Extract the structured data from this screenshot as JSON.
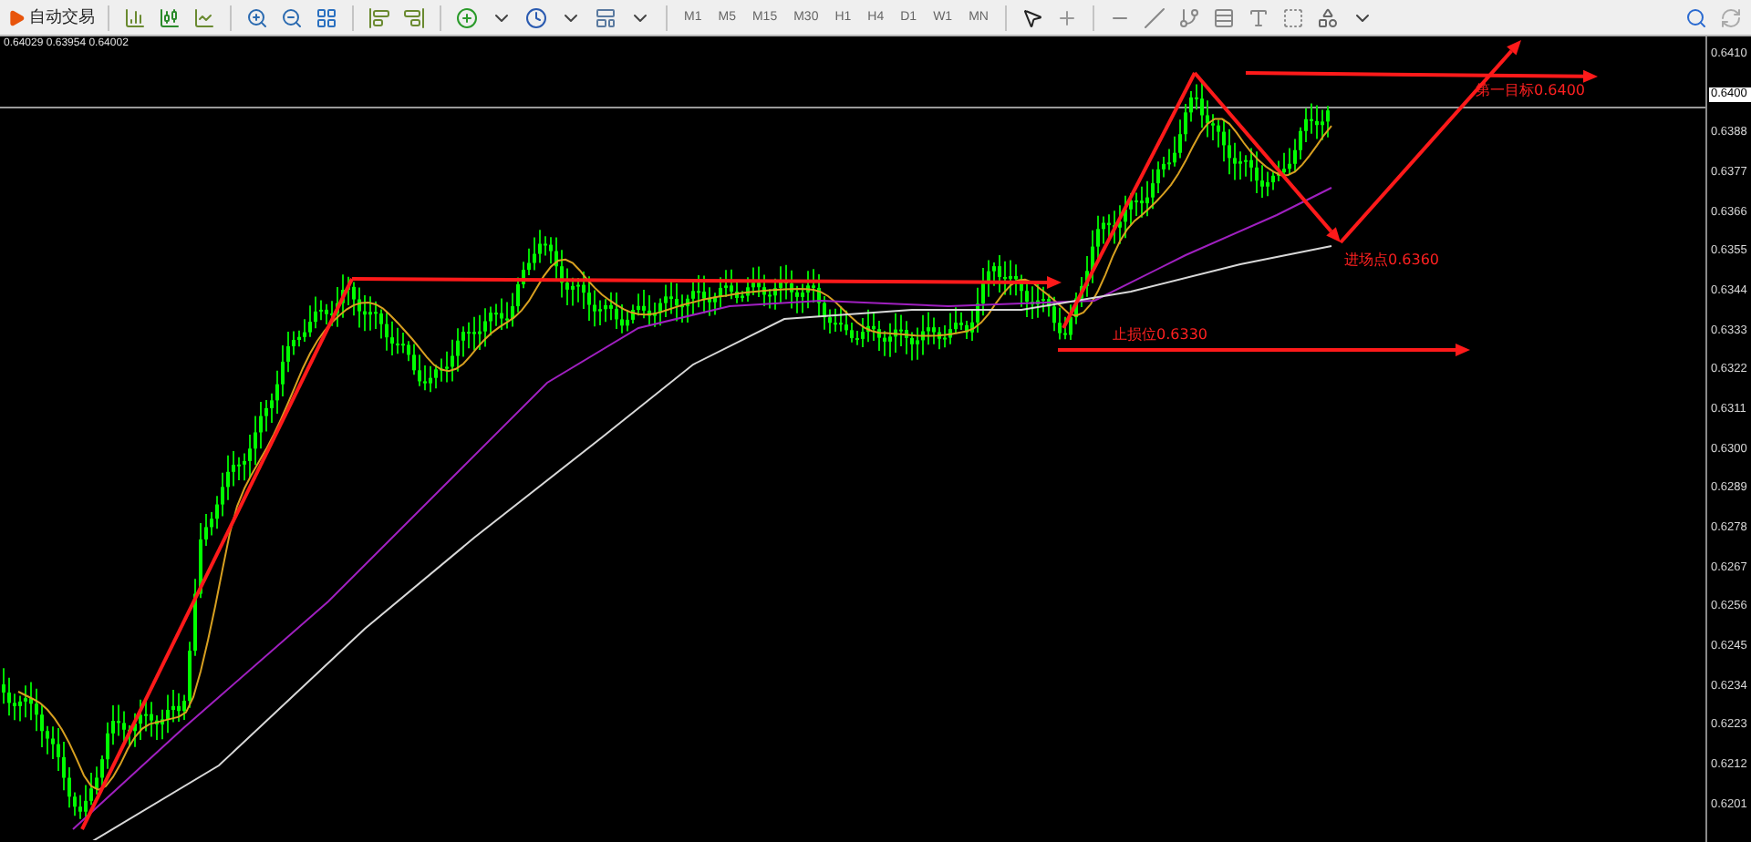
{
  "toolbar": {
    "autotrade_label": "自动交易",
    "timeframes": [
      "M1",
      "M5",
      "M15",
      "M30",
      "H1",
      "H4",
      "D1",
      "W1",
      "MN"
    ]
  },
  "chart": {
    "ohlc": "0.64029 0.63954 0.64002",
    "annotations": [
      {
        "text": "第一目标0.6400"
      },
      {
        "text": "进场点0.6360"
      },
      {
        "text": "止损位0.6330"
      }
    ]
  },
  "price_axis": [
    {
      "text": "0.6410",
      "highlighted": false
    },
    {
      "text": "0.6400",
      "highlighted": true
    },
    {
      "text": "0.6388",
      "highlighted": false
    },
    {
      "text": "0.6377",
      "highlighted": false
    },
    {
      "text": "0.6366",
      "highlighted": false
    },
    {
      "text": "0.6355",
      "highlighted": false
    },
    {
      "text": "0.6344",
      "highlighted": false
    },
    {
      "text": "0.6333",
      "highlighted": false
    },
    {
      "text": "0.6322",
      "highlighted": false
    },
    {
      "text": "0.6311",
      "highlighted": false
    },
    {
      "text": "0.6300",
      "highlighted": false
    },
    {
      "text": "0.6289",
      "highlighted": false
    },
    {
      "text": "0.6278",
      "highlighted": false
    },
    {
      "text": "0.6267",
      "highlighted": false
    },
    {
      "text": "0.6256",
      "highlighted": false
    },
    {
      "text": "0.6245",
      "highlighted": false
    },
    {
      "text": "0.6234",
      "highlighted": false
    },
    {
      "text": "0.6223",
      "highlighted": false
    },
    {
      "text": "0.6212",
      "highlighted": false
    },
    {
      "text": "0.6201",
      "highlighted": false
    }
  ]
}
